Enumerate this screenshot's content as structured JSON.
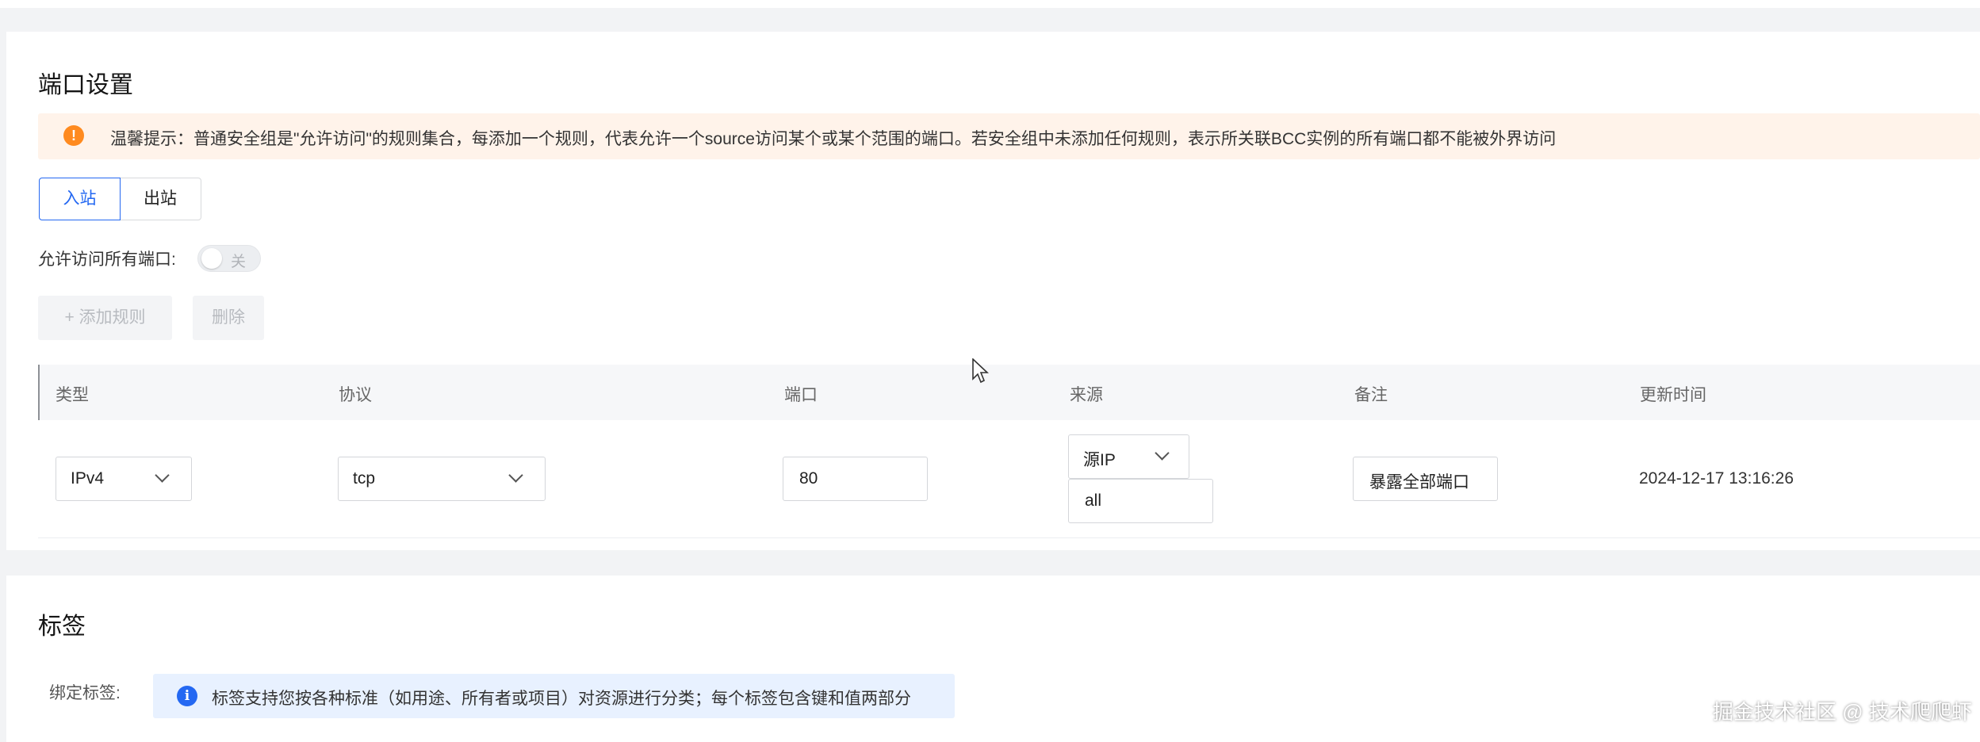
{
  "ports_section": {
    "title": "端口设置",
    "notice": {
      "icon": "warning-icon",
      "text": "温馨提示：普通安全组是\"允许访问\"的规则集合，每添加一个规则，代表允许一个source访问某个或某个范围的端口。若安全组中未添加任何规则，表示所关联BCC实例的所有端口都不能被外界访问"
    },
    "tabs": [
      {
        "label": "入站",
        "active": true
      },
      {
        "label": "出站",
        "active": false
      }
    ],
    "allow_all_ports": {
      "label": "允许访问所有端口:",
      "toggle_text": "关",
      "enabled": false
    },
    "buttons": {
      "add_rule": "+ 添加规则",
      "delete": "删除"
    },
    "table": {
      "headers": [
        "类型",
        "协议",
        "端口",
        "来源",
        "备注",
        "更新时间"
      ],
      "rows": [
        {
          "type": "IPv4",
          "protocol": "tcp",
          "port": "80",
          "source_type": "源IP",
          "source_value": "all",
          "remark": "暴露全部端口",
          "updated": "2024-12-17 13:16:26"
        }
      ]
    }
  },
  "tags_section": {
    "title": "标签",
    "bind_label": "绑定标签:",
    "info": {
      "icon": "info-icon",
      "text": "标签支持您按各种标准（如用途、所有者或项目）对资源进行分类；每个标签包含键和值两部分"
    }
  },
  "watermark": "掘金技术社区 @ 技术爬爬虾",
  "colors": {
    "accent": "#2468f2",
    "warning": "#ff8a1f",
    "notice_bg": "#fff3ea",
    "info_bg": "#e8f1ff"
  }
}
